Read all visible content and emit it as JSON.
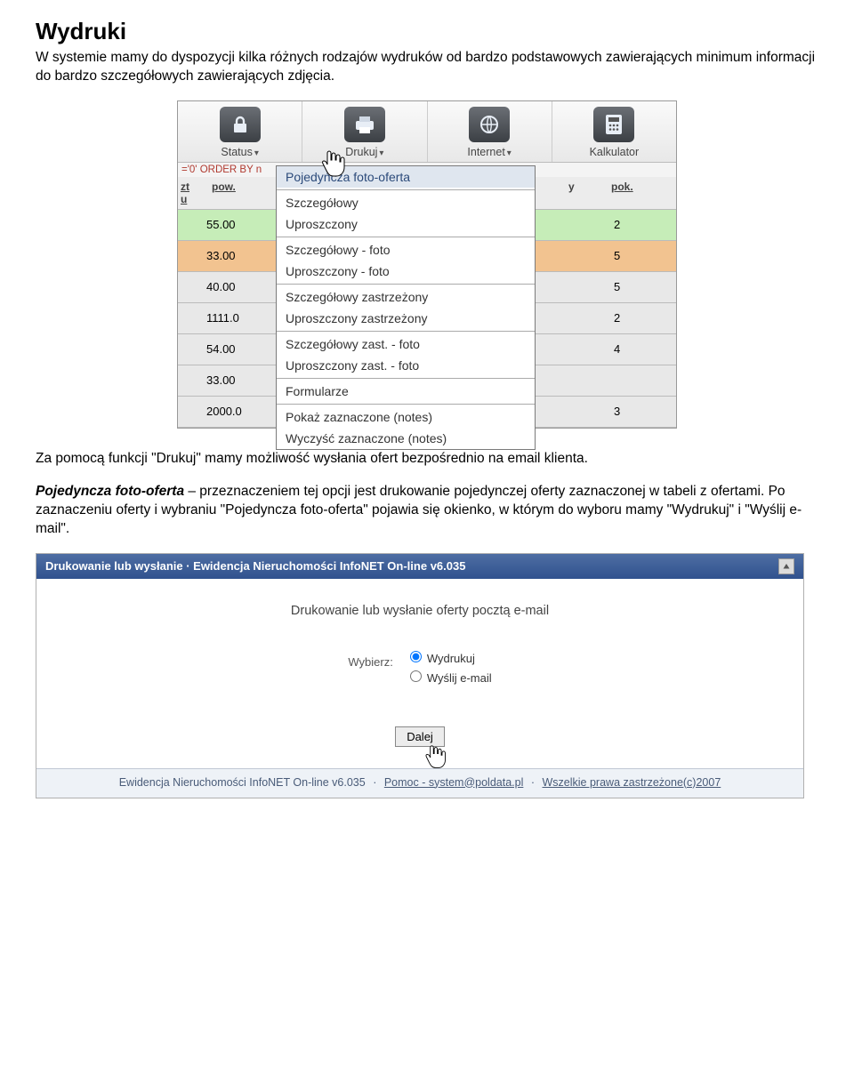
{
  "doc": {
    "heading": "Wydruki",
    "para1": "W systemie mamy do dyspozycji kilka różnych rodzajów wydruków od bardzo podstawowych zawierających minimum informacji do bardzo szczegółowych zawierających zdjęcia.",
    "para2": "Za pomocą funkcji \"Drukuj\" mamy możliwość wysłania ofert bezpośrednio na email klienta.",
    "para3_bold": "Pojedyncza foto-oferta",
    "para3_rest": " – przeznaczeniem tej opcji jest drukowanie pojedynczej oferty zaznaczonej w tabeli z ofertami. Po zaznaczeniu oferty i wybraniu \"Pojedyncza foto-oferta\" pojawia się okienko, w którym do wyboru mamy \"Wydrukuj\" i \"Wyślij e-mail\"."
  },
  "shot1": {
    "toolbar": [
      {
        "label": "Status",
        "sub": "▾",
        "icon": "lock-icon"
      },
      {
        "label": "Drukuj",
        "sub": "▾",
        "icon": "printer-icon"
      },
      {
        "label": "Internet",
        "sub": "▾",
        "icon": "globe-icon"
      },
      {
        "label": "Kalkulator",
        "sub": "",
        "icon": "calculator-icon"
      }
    ],
    "sqlLine": "='0' ORDER BY n",
    "header": {
      "col1": "zt\nu",
      "col2": "pow.",
      "col3": "y",
      "col4": "pok."
    },
    "rows": [
      {
        "value": "55.00",
        "pok": "2",
        "class": "bg-green"
      },
      {
        "value": "33.00",
        "pok": "5",
        "class": "bg-orange"
      },
      {
        "value": "40.00",
        "pok": "5",
        "class": "bg-grey"
      },
      {
        "value": "1111.0",
        "pok": "2",
        "class": "bg-grey"
      },
      {
        "value": "54.00",
        "pok": "4",
        "class": "bg-grey"
      },
      {
        "value": "33.00",
        "pok": "",
        "class": "bg-grey"
      },
      {
        "value": "2000.0",
        "pok": "3",
        "class": "bg-grey"
      }
    ],
    "menu": [
      {
        "label": "Pojedyńcza foto-oferta",
        "hl": true
      },
      {
        "sep": true
      },
      {
        "label": "Szczegółowy"
      },
      {
        "label": "Uproszczony"
      },
      {
        "sep": true
      },
      {
        "label": "Szczegółowy - foto"
      },
      {
        "label": "Uproszczony - foto"
      },
      {
        "sep": true
      },
      {
        "label": "Szczegółowy zastrzeżony"
      },
      {
        "label": "Uproszczony zastrzeżony"
      },
      {
        "sep": true
      },
      {
        "label": "Szczegółowy zast. - foto"
      },
      {
        "label": "Uproszczony zast. - foto"
      },
      {
        "sep": true
      },
      {
        "label": "Formularze"
      },
      {
        "sep": true
      },
      {
        "label": "Pokaż zaznaczone (notes)"
      },
      {
        "label": "Wyczyść zaznaczone (notes)"
      }
    ]
  },
  "shot2": {
    "title": "Drukowanie lub wysłanie · Ewidencja Nieruchomości InfoNET On-line v6.035",
    "heading": "Drukowanie lub wysłanie oferty pocztą e-mail",
    "chooseLabel": "Wybierz:",
    "opt1": "Wydrukuj",
    "opt2": "Wyślij e-mail",
    "button": "Dalej",
    "footer": {
      "a": "Ewidencja Nieruchomości InfoNET On-line v6.035",
      "b": "Pomoc - system@poldata.pl",
      "c": "Wszelkie prawa zastrzeżone(c)2007"
    }
  }
}
